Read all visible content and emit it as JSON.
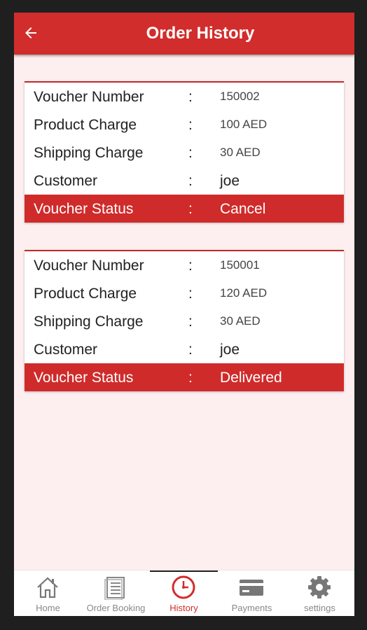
{
  "header": {
    "title": "Order History",
    "back_icon": "arrow-left-icon"
  },
  "colors": {
    "primary": "#d12d2c",
    "background": "#fdeff0",
    "nav_inactive": "#888888"
  },
  "field_labels": {
    "voucher_number": "Voucher Number",
    "product_charge": "Product Charge",
    "shipping_charge": "Shipping Charge",
    "customer": "Customer",
    "voucher_status": "Voucher Status",
    "separator": ":"
  },
  "orders": [
    {
      "voucher_number": "150002",
      "product_charge": "100 AED",
      "shipping_charge": "30 AED",
      "customer": "joe",
      "status": "Cancel"
    },
    {
      "voucher_number": "150001",
      "product_charge": "120 AED",
      "shipping_charge": "30 AED",
      "customer": "joe",
      "status": "Delivered"
    }
  ],
  "bottom_nav": [
    {
      "label": "Home",
      "icon": "home-icon",
      "active": false
    },
    {
      "label": "Order Booking",
      "icon": "document-icon",
      "active": false
    },
    {
      "label": "History",
      "icon": "clock-icon",
      "active": true
    },
    {
      "label": "Payments",
      "icon": "credit-card-icon",
      "active": false
    },
    {
      "label": "settings",
      "icon": "gear-icon",
      "active": false
    }
  ]
}
